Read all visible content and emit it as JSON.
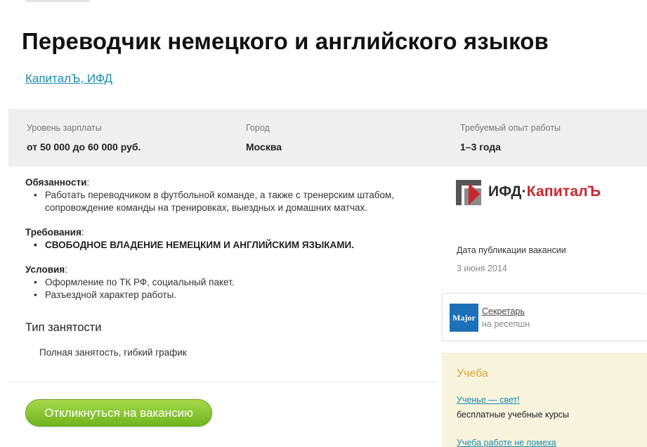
{
  "vacancy": {
    "title": "Переводчик немецкого и английского языков",
    "company": "КапиталЪ, ИФД"
  },
  "info": [
    {
      "label": "Уровень зарплаты",
      "value": "от 50 000 до 60 000 руб."
    },
    {
      "label": "Город",
      "value": "Москва"
    },
    {
      "label": "Требуемый опыт работы",
      "value": "1–3 года"
    }
  ],
  "description": {
    "duties": {
      "title": "Обязанности",
      "items": [
        "Работать переводчиком в футбольной команде, а также с тренерским штабом, сопровождение команды на тренировках, выездных и домашних матчах."
      ]
    },
    "requirements": {
      "title": "Требования",
      "items": [
        "СВОБОДНОЕ ВЛАДЕНИЕ НЕМЕЦКИМ И АНГЛИЙСКИМ ЯЗЫКАМИ."
      ]
    },
    "conditions": {
      "title": "Условия",
      "items": [
        "Оформление по ТК РФ, социальный пакет.",
        "Разъездной характер работы."
      ]
    },
    "colon": ":"
  },
  "employment": {
    "title": "Тип занятости",
    "value": "Полная занятость, гибкий график"
  },
  "apply_button": "Откликнуться на вакансию",
  "logo": {
    "text_dark": "ИФД·",
    "text_red": "КапиталЪ",
    "colors": {
      "gray": "#555555",
      "red": "#c8262c"
    }
  },
  "publication": {
    "label": "Дата публикации вакансии",
    "date": "3 июня 2014"
  },
  "promo": {
    "badge": "Major",
    "title": "Секретарь",
    "subtitle": "на ресепшн"
  },
  "study": {
    "title": "Учеба",
    "link": "Ученье — свет!",
    "text": "бесплатные учебные курсы",
    "link2": "Учеба работе не помеха"
  },
  "colors": {
    "link": "#1a8bb3",
    "button_green": "#7cc12a",
    "study_bg": "#f7f3dc",
    "study_title": "#d8a93a",
    "major_blue": "#1d6fb8"
  }
}
